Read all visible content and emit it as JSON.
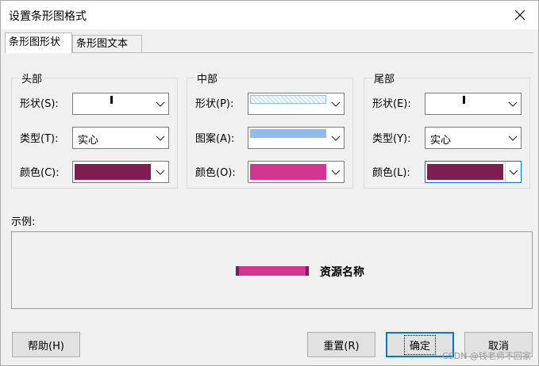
{
  "window": {
    "title": "设置条形图格式"
  },
  "tabs": [
    {
      "label": "条形图形状"
    },
    {
      "label": "条形图文本"
    }
  ],
  "groups": {
    "head": {
      "title": "头部",
      "shape_label": "形状(S):",
      "type_label": "类型(T):",
      "type_value": "实心",
      "color_label": "颜色(C):",
      "color": "#7f1d51"
    },
    "middle": {
      "title": "中部",
      "shape_label": "形状(P):",
      "pattern_label": "图案(A):",
      "color_label": "颜色(O):",
      "color": "#d1358d",
      "pattern_color": "#8fbbe6"
    },
    "tail": {
      "title": "尾部",
      "shape_label": "形状(E):",
      "type_label": "类型(Y):",
      "type_value": "实心",
      "color_label": "颜色(L):",
      "color": "#7f1d51"
    }
  },
  "example": {
    "label": "示例:",
    "text": "资源名称",
    "bar_color": "#d1358d",
    "end_color": "#7f1d51"
  },
  "buttons": {
    "help": "帮助(H)",
    "reset": "重置(R)",
    "ok": "确定",
    "cancel": "取消"
  },
  "watermark": "CSDN @钱老师不回家"
}
